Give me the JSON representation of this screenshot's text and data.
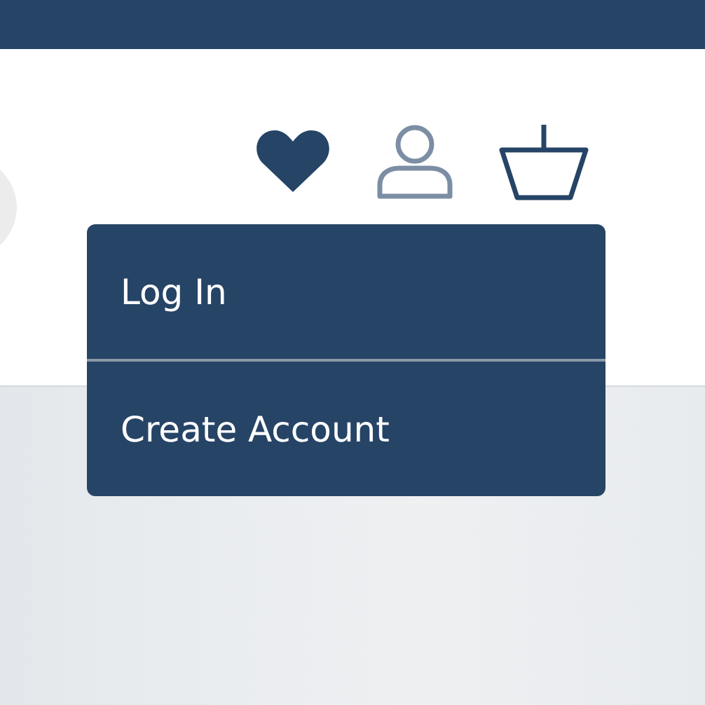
{
  "header_icons": [
    {
      "kind": "heart",
      "selected": false
    },
    {
      "kind": "user",
      "selected": true
    },
    {
      "kind": "basket",
      "selected": false
    }
  ],
  "menu": {
    "items": [
      {
        "label": "Log In"
      },
      {
        "label": "Create Account"
      }
    ]
  }
}
